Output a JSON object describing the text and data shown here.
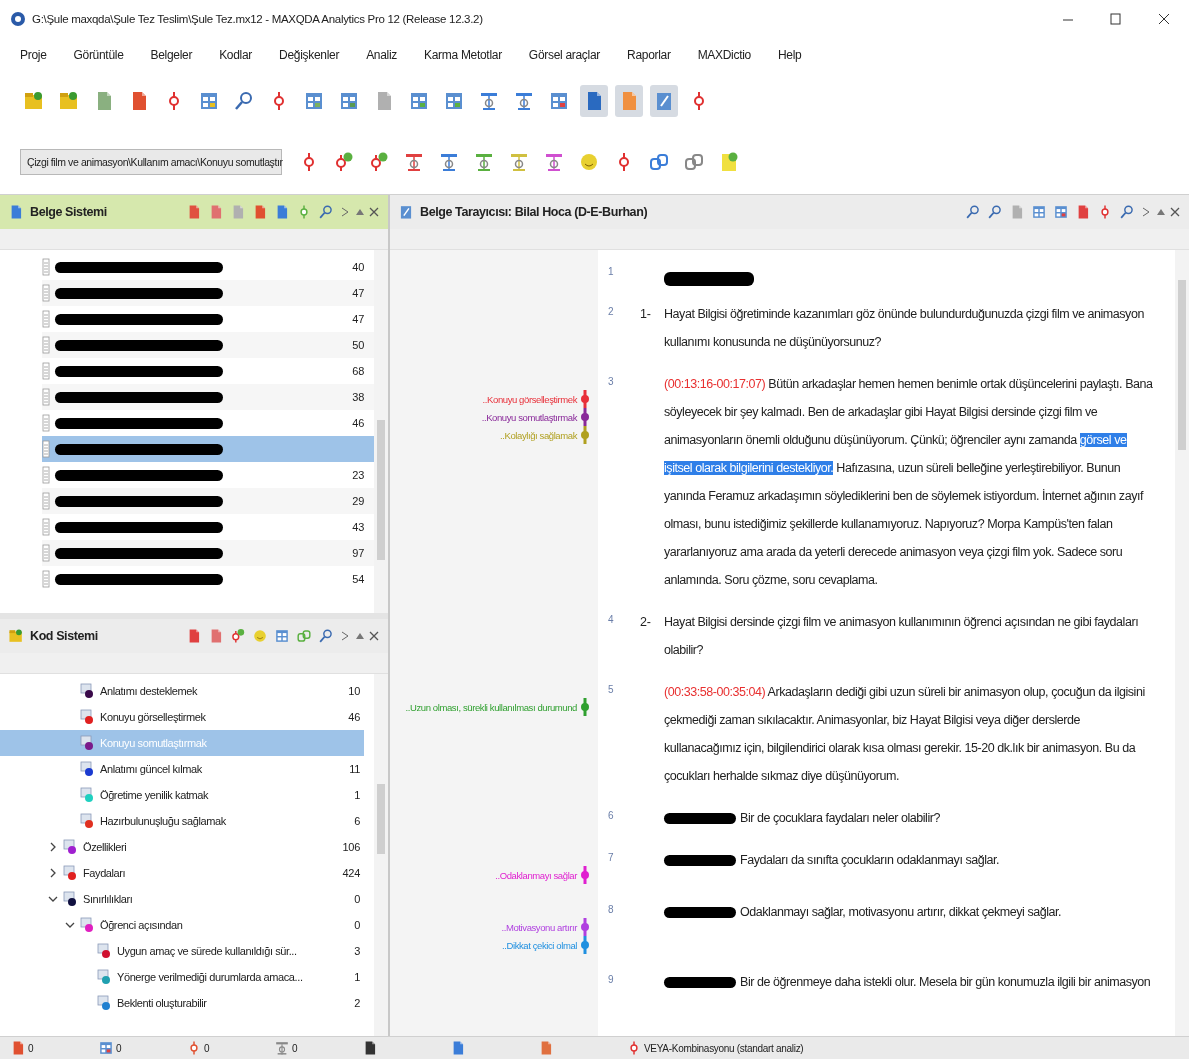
{
  "window": {
    "title": "G:\\Şule maxqda\\Şule Tez Teslim\\Şule Tez.mx12 - MAXQDA Analytics Pro 12  (Release 12.3.2)"
  },
  "menu": [
    "Proje",
    "Görüntüle",
    "Belgeler",
    "Kodlar",
    "Değişkenler",
    "Analiz",
    "Karma Metotlar",
    "Görsel araçlar",
    "Raporlar",
    "MAXDictio",
    "Help"
  ],
  "code_dropdown": {
    "value": "Çizgi film ve animasyon\\Kullanım amacı\\Konuyu somutlaştır"
  },
  "document_system": {
    "title": "Belge Sistemi",
    "rows": [
      {
        "redacted": true,
        "count": "40",
        "selected": false
      },
      {
        "redacted": true,
        "count": "47",
        "selected": false
      },
      {
        "redacted": true,
        "count": "47",
        "selected": false
      },
      {
        "redacted": true,
        "count": "50",
        "selected": false
      },
      {
        "redacted": true,
        "count": "68",
        "selected": false
      },
      {
        "redacted": true,
        "count": "38",
        "selected": false
      },
      {
        "redacted": true,
        "count": "46",
        "selected": false
      },
      {
        "redacted": true,
        "selected": true
      },
      {
        "redacted": true,
        "count": "23",
        "selected": false
      },
      {
        "redacted": true,
        "count": "29",
        "selected": false
      },
      {
        "redacted": true,
        "count": "43",
        "selected": false
      },
      {
        "redacted": true,
        "count": "97",
        "selected": false
      },
      {
        "redacted": true,
        "count": "54",
        "selected": false
      }
    ]
  },
  "code_system": {
    "title": "Kod Sistemi",
    "items": [
      {
        "children": [
          {
            "label": "Anlatımı desteklemek",
            "count": "10",
            "color": "#3a0a4a",
            "selected": false
          },
          {
            "label": "Konuyu görselleştirmek",
            "count": "46",
            "color": "#e02020",
            "selected": false
          },
          {
            "label": "Konuyu somutlaştırmak",
            "color": "#7a1a8a",
            "selected": true
          },
          {
            "label": "Anlatımı güncel kılmak",
            "count": "11",
            "color": "#1a3ad0",
            "selected": false
          },
          {
            "label": "Öğretime yenilik katmak",
            "count": "1",
            "color": "#20d0c0",
            "selected": false
          },
          {
            "label": "Hazırbulunuşluğu sağlamak",
            "count": "6",
            "color": "#e03020",
            "selected": false
          }
        ]
      },
      {
        "label": "Özellikleri",
        "count": "106",
        "color": "#a020d0",
        "selected": false,
        "expanded": false
      },
      {
        "label": "Faydaları",
        "count": "424",
        "color": "#e02020",
        "selected": false,
        "expanded": false
      },
      {
        "label": "Sınırlılıkları",
        "count": "0",
        "color": "#101040",
        "selected": false,
        "expanded": true,
        "children": [
          {
            "label": "Öğrenci açısından",
            "count": "0",
            "color": "#e020c0",
            "selected": false,
            "expanded": true,
            "children": [
              {
                "label": "Uygun amaç ve sürede kullanıldığı sür...",
                "count": "3",
                "color": "#d01030",
                "selected": false
              },
              {
                "label": "Yönerge verilmediği durumlarda amaca...",
                "count": "1",
                "color": "#20a0b0",
                "selected": false
              },
              {
                "label": "Beklenti oluşturabilir",
                "count": "2",
                "color": "#2080d0",
                "selected": false
              }
            ]
          }
        ]
      }
    ]
  },
  "document_browser": {
    "title": "Belge Tarayıcısı: Bilal Hoca (D-E-Burhan)",
    "paragraphs": [
      {
        "number": "1",
        "redacted": true
      },
      {
        "number": "2",
        "list_marker": "1-",
        "segments": [
          {
            "text": "Hayat Bilgisi öğretiminde kazanımları göz önünde bulundurduğunuzda çizgi film ve animasyon kullanımı konusunda ne düşünüyorsunuz?",
            "highlighted": false
          }
        ]
      },
      {
        "number": "3",
        "timestamp": "(00:13:16-00:17:07)",
        "segments": [
          {
            "text": " Bütün arkadaşlar hemen hemen benimle ortak düşüncelerini paylaştı. Bana söyleyecek bir şey kalmadı. Ben de arkadaşlar gibi Hayat Bilgisi dersinde çizgi film ve animasyonların önemli olduğunu düşünüyorum. Çünkü; öğrenciler aynı zamanda ",
            "highlighted": false
          },
          {
            "text": "görsel ve işitsel olarak bilgilerini destekliyor.",
            "highlighted": true
          },
          {
            "text": " Hafızasına, uzun süreli belleğine yerleştirebiliyor. Bunun yanında Feramuz arkadaşımın söylediklerini ben de söylemek istiyordum. İnternet ağının zayıf olması, bunu istediğimiz şekillerde kullanamıyoruz. Napıyoruz? Morpa Kampüs'ten falan yararlanıyoruz ama arada da yeterli derecede animasyon veya çizgi film yok. Sadece soru anlamında. Soru çözme, soru cevaplama.",
            "highlighted": false
          }
        ],
        "codings": [
          {
            "label": "..Konuyu görselleştirmek",
            "color": "#e8303a"
          },
          {
            "label": "..Konuyu somutlaştırmak",
            "color": "#8a2a9a"
          },
          {
            "label": "..Kolaylığı sağlamak",
            "color": "#b0a020"
          }
        ]
      },
      {
        "number": "4",
        "list_marker": "2-",
        "segments": [
          {
            "text": "Hayat Bilgisi dersinde çizgi film ve animasyon kullanımının öğrenci açısından ne gibi faydaları olabilir?",
            "highlighted": false
          }
        ]
      },
      {
        "number": "5",
        "timestamp": "(00:33:58-00:35:04)",
        "segments": [
          {
            "text": " Arkadaşların dediği gibi uzun süreli bir animasyon olup, çocuğun da ilgisini çekmediği zaman sıkılacaktır. Animasyonlar, biz Hayat Bilgisi veya diğer derslerde kullanacağımız için, bilgilendirici olarak kısa olması gerekir. 15-20 dk.lık bir animasyon. Bu da çocukları herhalde sıkmaz diye düşünüyorum.",
            "highlighted": false
          }
        ],
        "codings": [
          {
            "label": "..Uzun olması, sürekli kullanılması durumund",
            "color": "#30a030"
          }
        ]
      },
      {
        "number": "6",
        "redacted": true,
        "segments": [
          {
            "text": "Bir de çocuklara faydaları neler olabilir?",
            "highlighted": false
          }
        ]
      },
      {
        "number": "7",
        "redacted": true,
        "segments": [
          {
            "text": "Faydaları da sınıfta çocukların odaklanmayı sağlar.",
            "highlighted": false
          }
        ],
        "codings": [
          {
            "label": "..Odaklanmayı sağlar",
            "color": "#e020d0"
          }
        ]
      },
      {
        "number": "8",
        "redacted": true,
        "segments": [
          {
            "text": "Odaklanmayı sağlar, motivasyonu artırır, dikkat çekmeyi sağlar.",
            "highlighted": false
          }
        ],
        "codings": [
          {
            "label": "..Motivasyonu artırır",
            "color": "#b040e0"
          },
          {
            "label": "..Dikkat çekici olmal",
            "color": "#2090e0"
          }
        ]
      },
      {
        "number": "9",
        "redacted": true,
        "segments": [
          {
            "text": "Bir de öğrenmeye daha istekli olur. Mesela bir gün konumuzla ilgili bir animasyon",
            "highlighted": false
          }
        ]
      }
    ]
  },
  "status_bar": {
    "counts": [
      "0",
      "0",
      "0",
      "0"
    ],
    "mode": "VEYA-Kombinasyonu (standart analiz)"
  }
}
